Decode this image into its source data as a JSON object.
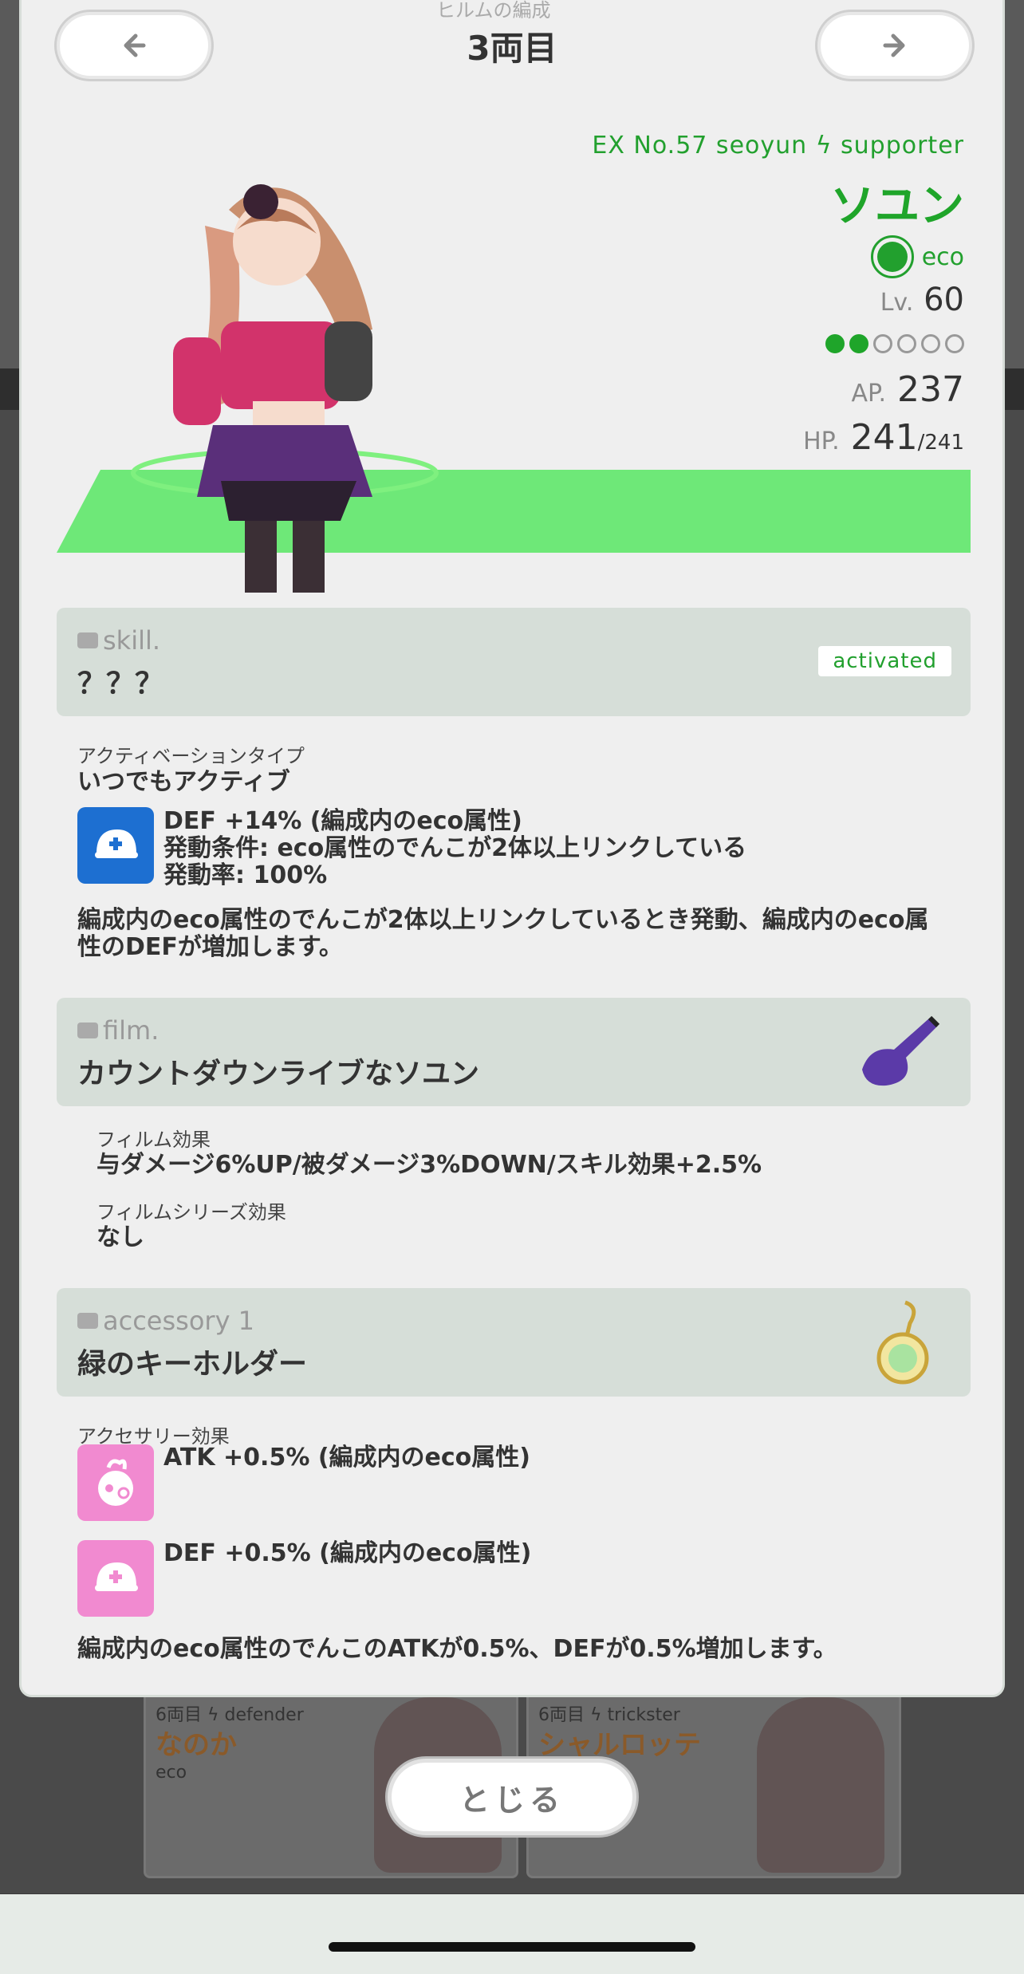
{
  "header": {
    "top_caption": "ヒルムの編成",
    "title": "3両目"
  },
  "character": {
    "subtitle": "EX No.57 seoyun ϟ supporter",
    "name": "ソユン",
    "attribute": "eco",
    "level_label": "Lv.",
    "level": "60",
    "stars_filled": 2,
    "stars_total": 6,
    "ap_label": "AP.",
    "ap": "237",
    "hp_label": "HP.",
    "hp": "241",
    "hp_max": "/241"
  },
  "skill": {
    "label": "skill.",
    "name": "？？？",
    "status": "activated",
    "activation_type_label": "アクティベーションタイプ",
    "activation_type": "いつでもアクティブ",
    "effect_line1": "DEF +14% (編成内のeco属性)",
    "effect_line2": "発動条件: eco属性のでんこが2体以上リンクしている",
    "effect_line3": "発動率: 100%",
    "description_line1": "編成内のeco属性のでんこが2体以上リンクしているとき発動、編成内のeco属",
    "description_line2": "性のDEFが増加します。"
  },
  "film": {
    "label": "film.",
    "name": "カウントダウンライブなソユン",
    "effect_label": "フィルム効果",
    "effect": "与ダメージ6%UP/被ダメージ3%DOWN/スキル効果+2.5%",
    "series_label": "フィルムシリーズ効果",
    "series_effect": "なし"
  },
  "accessory": {
    "label": "accessory 1",
    "name": "緑のキーホルダー",
    "effect_label": "アクセサリー効果",
    "effect1": "ATK +0.5% (編成内のeco属性)",
    "effect2": "DEF +0.5% (編成内のeco属性)",
    "description": "編成内のeco属性のでんこのATKが0.5%、DEFが0.5%増加します。"
  },
  "background": {
    "card1": {
      "rank": "6両目 ϟ defender",
      "name": "なのか",
      "attr": "eco"
    },
    "card2": {
      "rank": "6両目 ϟ trickster",
      "name": "シャルロッテ"
    }
  },
  "footer": {
    "close_label": "とじる"
  },
  "colors": {
    "accent_green": "#1fa52a",
    "band_green": "#6ee878",
    "section_bg": "#d6ded8",
    "skill_icon": "#1d6fd1",
    "accessory_icon": "#f18ad0"
  }
}
